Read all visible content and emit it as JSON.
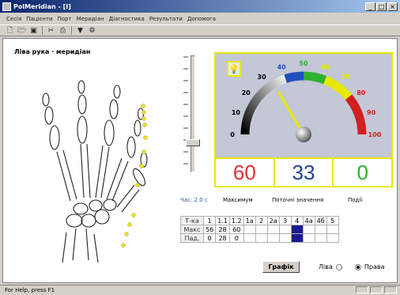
{
  "window": {
    "title": "PolMeridian - [I]"
  },
  "window_buttons": [
    "_",
    "□",
    "×"
  ],
  "menu": [
    "Сесія",
    "Пацієнти",
    "Порт",
    "Меридіан",
    "Діагностика",
    "Результати",
    "Допомога"
  ],
  "toolbar_icons": [
    "new-icon",
    "open-icon",
    "save-icon",
    "cut-icon",
    "print-icon",
    "filter-icon",
    "settings-icon"
  ],
  "meridian_title": "Ліва рука · меридіан",
  "gauge": {
    "scale_labels": [
      "0",
      "10",
      "20",
      "30",
      "40",
      "50",
      "60",
      "70",
      "80",
      "90",
      "100"
    ],
    "needle_value": 33,
    "colors": {
      "blue": "#2050c0",
      "green": "#30b030",
      "yellow": "#e8e800",
      "red": "#d02020",
      "panel_border": "#e8e800",
      "panel_bg": "#c3c7d6"
    }
  },
  "readouts": {
    "maximum": "60",
    "current": "33",
    "events": "0"
  },
  "labels": {
    "time": "Час: 2.0 с",
    "maximum": "Максимум",
    "current_values": "Поточні значення",
    "events": "Події"
  },
  "table": {
    "header_label": "Т-ка",
    "columns": [
      "1",
      "1.1",
      "1.2",
      "1a",
      "2",
      "2a",
      "3",
      "4",
      "4a",
      "4б",
      "5"
    ],
    "rows": [
      {
        "label": "Макс",
        "values": [
          "56",
          "28",
          "60",
          "",
          "",
          "",
          "",
          "",
          "",
          "",
          ""
        ]
      },
      {
        "label": "Пад.",
        "values": [
          "0",
          "28",
          "0",
          "",
          "",
          "",
          "",
          "",
          "",
          "",
          ""
        ]
      }
    ],
    "selected_column": 7
  },
  "buttons": {
    "graph": "Графік"
  },
  "radio": {
    "left_label": "Ліва",
    "right_label": "Права",
    "selected": "right"
  },
  "status": {
    "text": "For Help, press F1"
  }
}
